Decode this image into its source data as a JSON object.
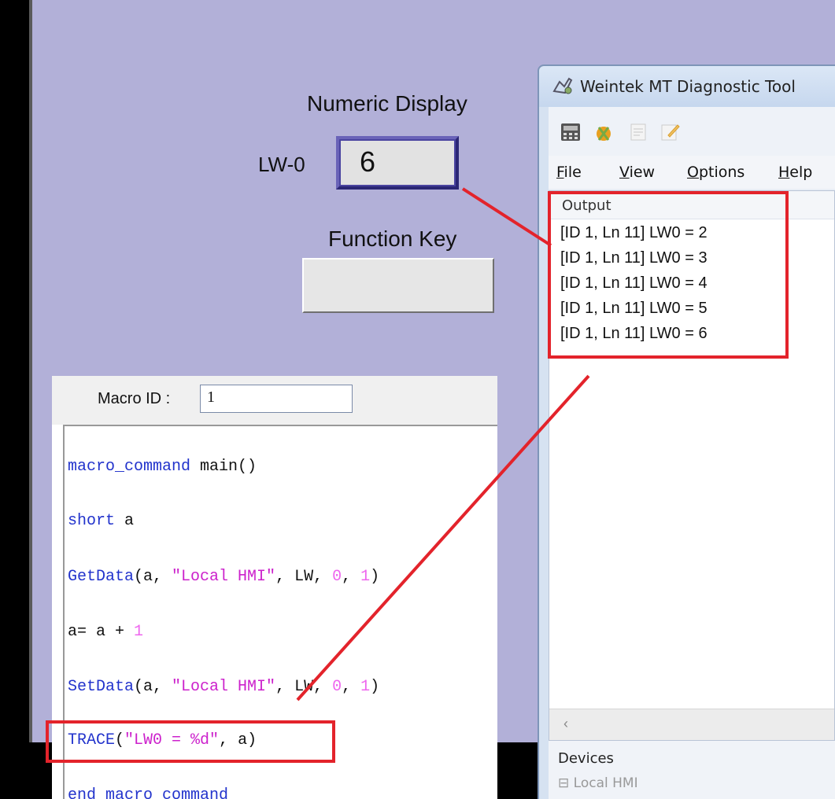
{
  "hmi": {
    "numeric_title": "Numeric Display",
    "lw_label": "LW-0",
    "numeric_value": "6",
    "function_key_title": "Function Key"
  },
  "macro": {
    "id_label": "Macro ID :",
    "id_value": "1",
    "code": [
      {
        "parts": [
          {
            "t": "macro_command",
            "c": "kw"
          },
          {
            "t": " main()",
            "c": ""
          }
        ]
      },
      {
        "parts": [
          {
            "t": "short",
            "c": "kw"
          },
          {
            "t": " a",
            "c": ""
          }
        ]
      },
      {
        "parts": [
          {
            "t": "GetData",
            "c": "kw"
          },
          {
            "t": "(a, ",
            "c": ""
          },
          {
            "t": "\"Local HMI\"",
            "c": "str"
          },
          {
            "t": ", LW, ",
            "c": ""
          },
          {
            "t": "0",
            "c": "num"
          },
          {
            "t": ", ",
            "c": ""
          },
          {
            "t": "1",
            "c": "num"
          },
          {
            "t": ")",
            "c": ""
          }
        ]
      },
      {
        "parts": [
          {
            "t": "a= a + ",
            "c": ""
          },
          {
            "t": "1",
            "c": "num"
          }
        ]
      },
      {
        "parts": [
          {
            "t": "SetData",
            "c": "kw"
          },
          {
            "t": "(a, ",
            "c": ""
          },
          {
            "t": "\"Local HMI\"",
            "c": "str"
          },
          {
            "t": ", LW, ",
            "c": ""
          },
          {
            "t": "0",
            "c": "num"
          },
          {
            "t": ", ",
            "c": ""
          },
          {
            "t": "1",
            "c": "num"
          },
          {
            "t": ")",
            "c": ""
          }
        ]
      },
      {
        "parts": [
          {
            "t": "TRACE",
            "c": "kw"
          },
          {
            "t": "(",
            "c": ""
          },
          {
            "t": "\"LW0 = %d\"",
            "c": "str"
          },
          {
            "t": ", a)",
            "c": ""
          }
        ]
      },
      {
        "parts": [
          {
            "t": "end macro_command",
            "c": "kw"
          }
        ]
      }
    ]
  },
  "diagnostic": {
    "title": "Weintek MT Diagnostic Tool",
    "menus": [
      {
        "label": "File",
        "key": "F"
      },
      {
        "label": "View",
        "key": "V"
      },
      {
        "label": "Options",
        "key": "O"
      },
      {
        "label": "Help",
        "key": "H"
      }
    ],
    "output_title": "Output",
    "output_lines": [
      "[ID 1, Ln 11] LW0 = 2",
      "[ID 1, Ln 11] LW0 = 3",
      "[ID 1, Ln 11] LW0 = 4",
      "[ID 1, Ln 11] LW0 = 5",
      "[ID 1, Ln 11] LW0 = 6"
    ],
    "scroll_left": "‹",
    "devices_title": "Devices",
    "devices_sub": "⊟  Local HMI"
  },
  "colors": {
    "hmi_background": "#b2b0d8",
    "annotation": "#e3232b",
    "keyword": "#2233cc",
    "string": "#cc22cc",
    "number": "#ee66ee"
  }
}
